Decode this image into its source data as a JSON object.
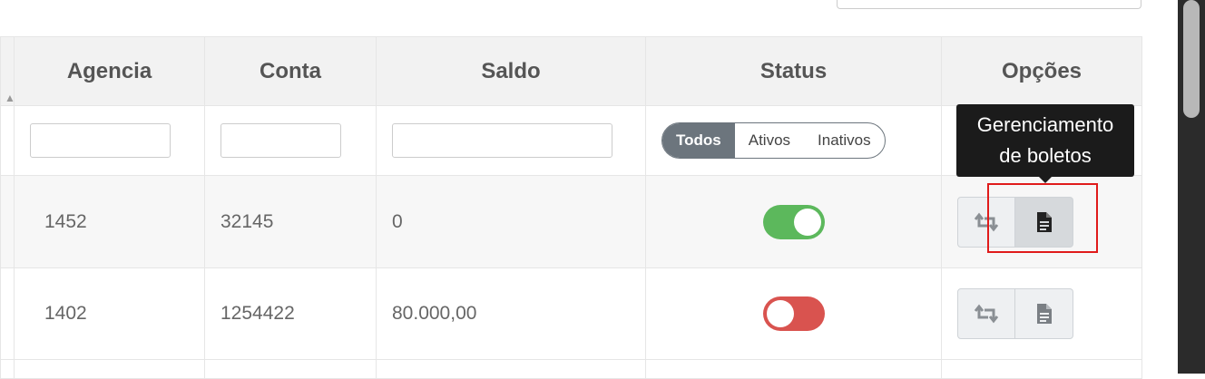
{
  "table": {
    "headers": {
      "agencia": "Agencia",
      "conta": "Conta",
      "saldo": "Saldo",
      "status": "Status",
      "opcoes": "Opções"
    },
    "status_filter": {
      "options": [
        "Todos",
        "Ativos",
        "Inativos"
      ],
      "selected": "Todos"
    },
    "rows": [
      {
        "agencia": "1452",
        "conta": "32145",
        "saldo": "0",
        "active": true
      },
      {
        "agencia": "1402",
        "conta": "1254422",
        "saldo": "80.000,00",
        "active": false
      }
    ]
  },
  "icons": {
    "sort": "sort-arrow-icon",
    "transfer": "retweet-icon",
    "boleto": "file-text-icon"
  },
  "tooltip": {
    "line1": "Gerenciamento",
    "line2": "de boletos"
  },
  "colors": {
    "active": "#5cb85c",
    "inactive": "#d9534f",
    "segment_active": "#6c757d",
    "highlight": "#e01b1b"
  }
}
